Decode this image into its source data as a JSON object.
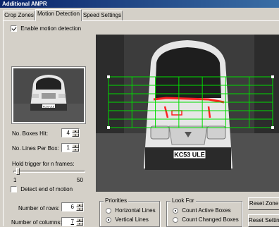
{
  "window": {
    "title": "Additional ANPR"
  },
  "tabs": [
    {
      "label": "Crop Zones"
    },
    {
      "label": "Motion Detection"
    },
    {
      "label": "Speed Settings"
    }
  ],
  "motion": {
    "enable_label": "Enable motion detection",
    "enable_checked": true,
    "boxes_hit_label": "No. Boxes Hit:",
    "boxes_hit_value": "4",
    "lines_per_box_label": "No. Lines Per Box:",
    "lines_per_box_value": "1",
    "hold_trigger_label": "Hold trigger for n frames:",
    "slider_min": "1",
    "slider_max": "50",
    "slider_value": 3,
    "detect_end_label": "Detect end of motion",
    "detect_end_checked": false,
    "rows_label": "Number of rows:",
    "rows_value": "6",
    "columns_label": "Number of columns:",
    "columns_value": "7"
  },
  "video": {
    "plate_text": "KC53 ULE"
  },
  "priorities": {
    "title": "Priorities",
    "options": [
      {
        "label": "Horizontal Lines",
        "checked": false
      },
      {
        "label": "Vertical Lines",
        "checked": true
      }
    ]
  },
  "look_for": {
    "title": "Look For",
    "options": [
      {
        "label": "Count Active Boxes",
        "checked": true
      },
      {
        "label": "Count Changed Boxes",
        "checked": false
      }
    ]
  },
  "buttons": {
    "reset_zone": "Reset Zone",
    "reset_settings": "Reset Settings"
  },
  "colors": {
    "grid": "#00dd00",
    "active": "#ff2020",
    "titlebar": "#0a246a"
  }
}
